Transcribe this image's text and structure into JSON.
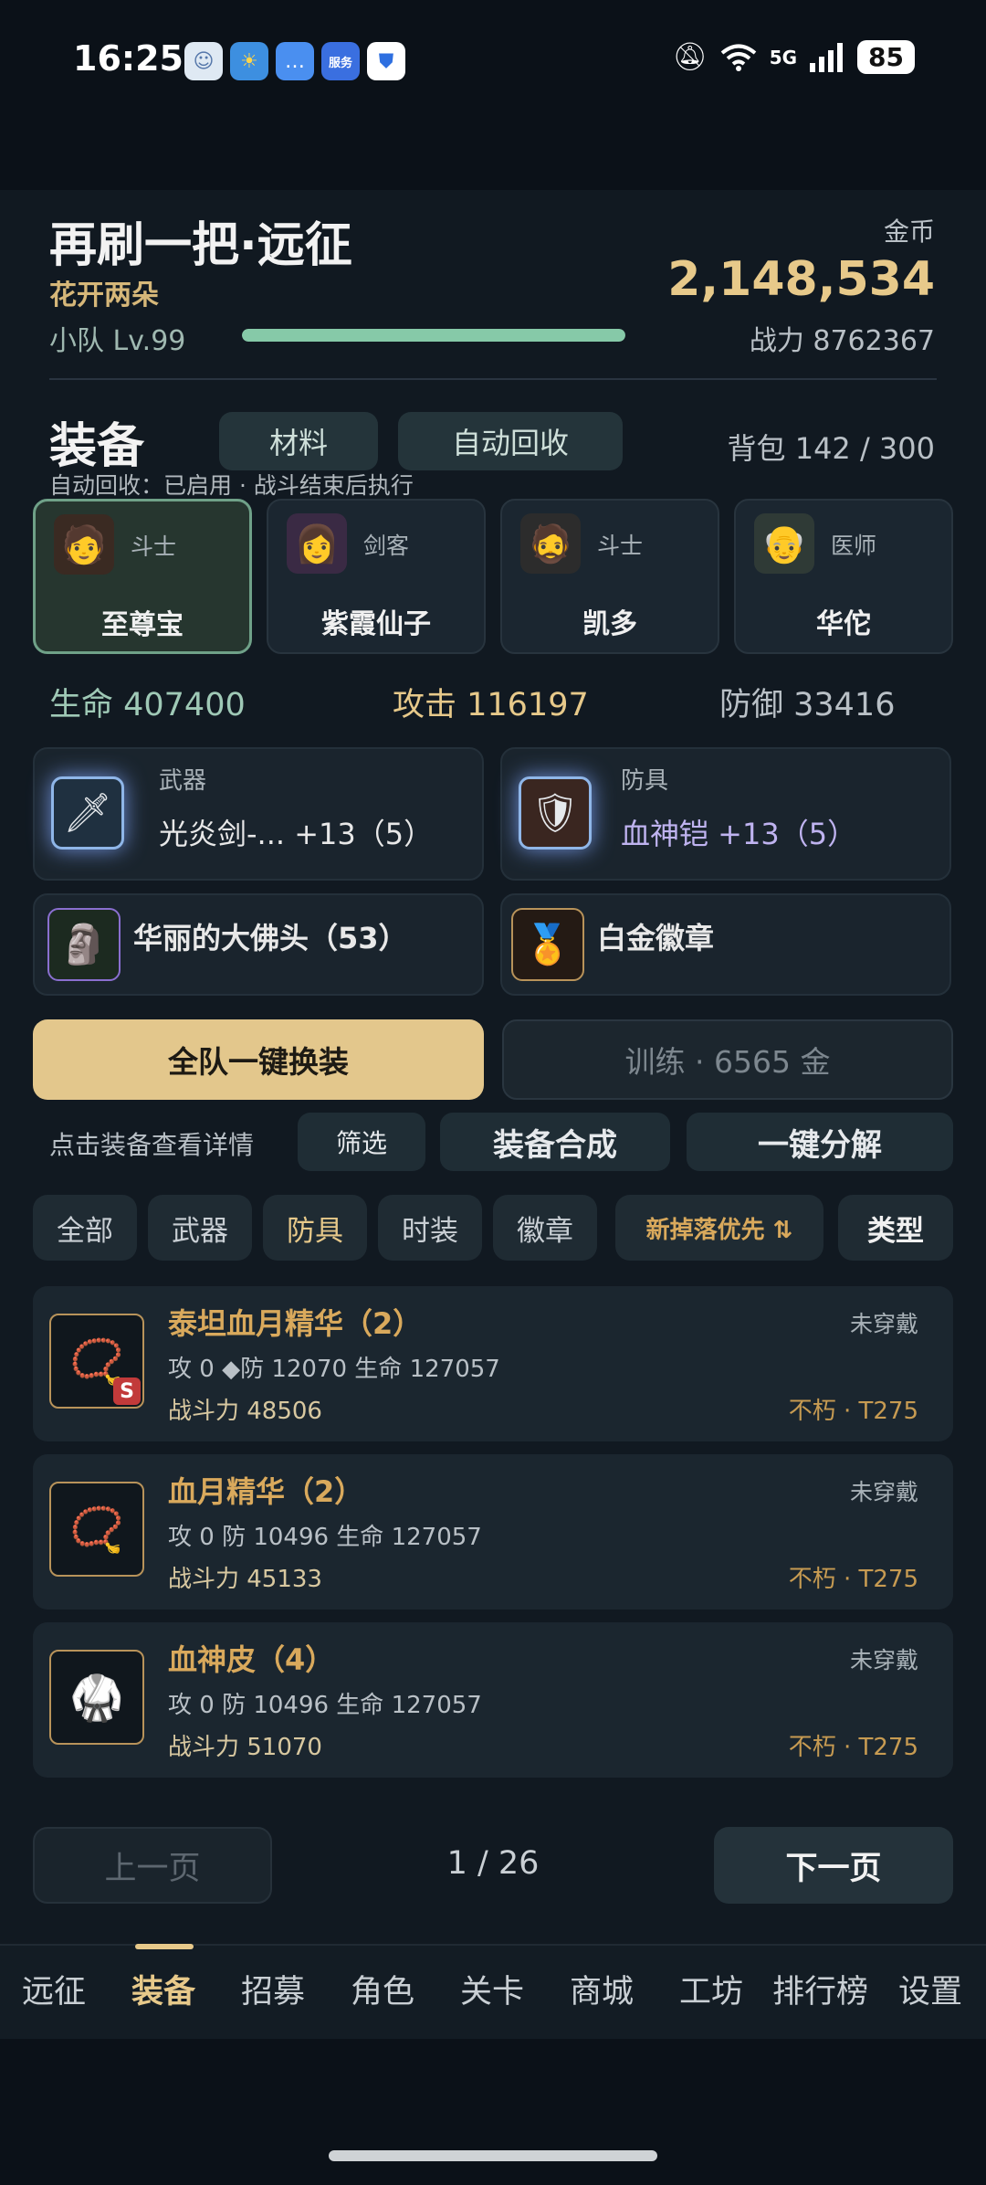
{
  "status_bar": {
    "time": "16:25",
    "battery": "85",
    "network": "5G",
    "app_icons": [
      "chat-bubble-icon",
      "weather-icon",
      "message-icon",
      "service-icon",
      "shield-icon"
    ],
    "service_label": "服务"
  },
  "header": {
    "title": "再刷一把·远征",
    "subtitle": "花开两朵",
    "level": "小队 Lv.99",
    "level_progress": 1.0,
    "gold_label": "金币",
    "gold_value": "2,148,534",
    "power": "战力 8762367"
  },
  "equipment": {
    "title": "装备",
    "materials_btn": "材料",
    "auto_recycle_btn": "自动回收",
    "bag": "背包 142 / 300",
    "auto_note": "自动回收：已启用 · 战斗结束后执行"
  },
  "heroes": [
    {
      "role": "斗士",
      "name": "至尊宝",
      "selected": true
    },
    {
      "role": "剑客",
      "name": "紫霞仙子",
      "selected": false
    },
    {
      "role": "斗士",
      "name": "凯多",
      "selected": false
    },
    {
      "role": "医师",
      "name": "华佗",
      "selected": false
    }
  ],
  "stats": {
    "hp": "生命 407400",
    "atk": "攻击 116197",
    "def": "防御 33416"
  },
  "slots": {
    "weapon": {
      "type": "武器",
      "name": "光炎剑-... +13（5）"
    },
    "armor": {
      "type": "防具",
      "name": "血神铠 +13（5）"
    },
    "accessory": {
      "name": "华丽的大佛头（53）"
    },
    "badge": {
      "name": "白金徽章"
    }
  },
  "actions": {
    "equip_all": "全队一键换装",
    "train": "训练 · 6565 金",
    "hint": "点击装备查看详情",
    "filter": "筛选",
    "synth": "装备合成",
    "decompose": "一键分解"
  },
  "filters": [
    "全部",
    "武器",
    "防具",
    "时装",
    "徽章",
    "新掉落优先 ⇅",
    "类型"
  ],
  "items": [
    {
      "name": "泰坦血月精华（2）",
      "stats": "攻 0  ◆防 12070  生命 127057",
      "cp": "战斗力 48506",
      "status": "未穿戴",
      "tier": "不朽 · T275",
      "badge": "S"
    },
    {
      "name": "血月精华（2）",
      "stats": "攻 0  防 10496  生命 127057",
      "cp": "战斗力 45133",
      "status": "未穿戴",
      "tier": "不朽 · T275",
      "badge": ""
    },
    {
      "name": "血神皮（4）",
      "stats": "攻 0  防 10496  生命 127057",
      "cp": "战斗力 51070",
      "status": "未穿戴",
      "tier": "不朽 · T275",
      "badge": ""
    }
  ],
  "pagination": {
    "prev": "上一页",
    "page": "1 / 26",
    "next": "下一页"
  },
  "nav": [
    "远征",
    "装备",
    "招募",
    "角色",
    "关卡",
    "商城",
    "工坊",
    "排行榜",
    "设置"
  ],
  "colors": {
    "accent_gold": "#e7c98a",
    "level_bar": "#86c9a8",
    "item_name": "#d9a95c",
    "tier": "#c79b52"
  }
}
